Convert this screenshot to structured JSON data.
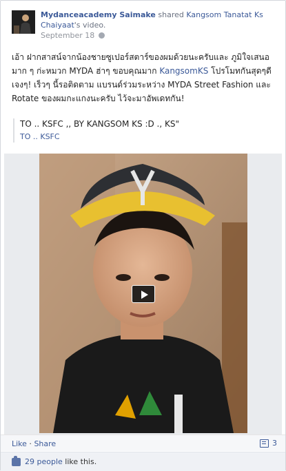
{
  "post": {
    "author": "Mydanceacademy Saimake",
    "action_text": " shared ",
    "shared_from": "Kangsom Tanatat Ks Chaiyaat",
    "shared_suffix": "'s video.",
    "date": "September 18",
    "privacy_icon": "globe-icon",
    "message_part1": "เอ้า ฝากสาสน์จากน้องชายซูเปอร์สตาร์ของผมด้วยนะครับและ ภูมิใจเสนอมาก ๆ ก่ะหมวก MYDA ฮ่าๆ ขอบคุณมาก ",
    "message_link": "KangsomKS",
    "message_part2": " โปรโมทกันสุดๆดีเจงๆ! เร็วๆ นี้รอติดตาม แบรนด์ร่วมระหว่าง MYDA Street Fashion และ Rotate ของผมกะแกงนะครับ ไว้จะมาอัพเดทกัน!"
  },
  "shared_video": {
    "title": "TO .. KSFC ,, BY KANGSOM KS :D ., KS\"",
    "source": "TO .. KSFC",
    "play_icon": "play-icon"
  },
  "actions": {
    "like": "Like",
    "separator": " · ",
    "share": "Share",
    "comment_icon": "comment-icon",
    "comment_count": "3"
  },
  "likes": {
    "icon": "thumbs-up-icon",
    "count_text": "29 people",
    "suffix": " like this."
  },
  "colors": {
    "link": "#3b5998",
    "footer_bg": "#f6f7f9",
    "likes_bg": "#eff1f5"
  }
}
